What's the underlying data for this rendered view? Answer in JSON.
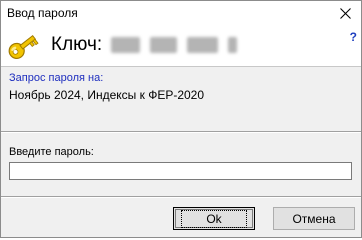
{
  "window": {
    "title": "Ввод пароля"
  },
  "header": {
    "key_label": "Ключ:",
    "help_label": "?"
  },
  "request": {
    "caption": "Запрос пароля на:",
    "value": "Ноябрь 2024, Индексы к ФЕР-2020"
  },
  "password": {
    "label": "Введите пароль:",
    "value": "",
    "placeholder": ""
  },
  "buttons": {
    "ok": "Ok",
    "cancel": "Отмена"
  },
  "icons": {
    "key": "key-icon",
    "close": "close-icon"
  },
  "colors": {
    "caption_blue": "#1f2fbf",
    "key_gold": "#e8b800"
  }
}
